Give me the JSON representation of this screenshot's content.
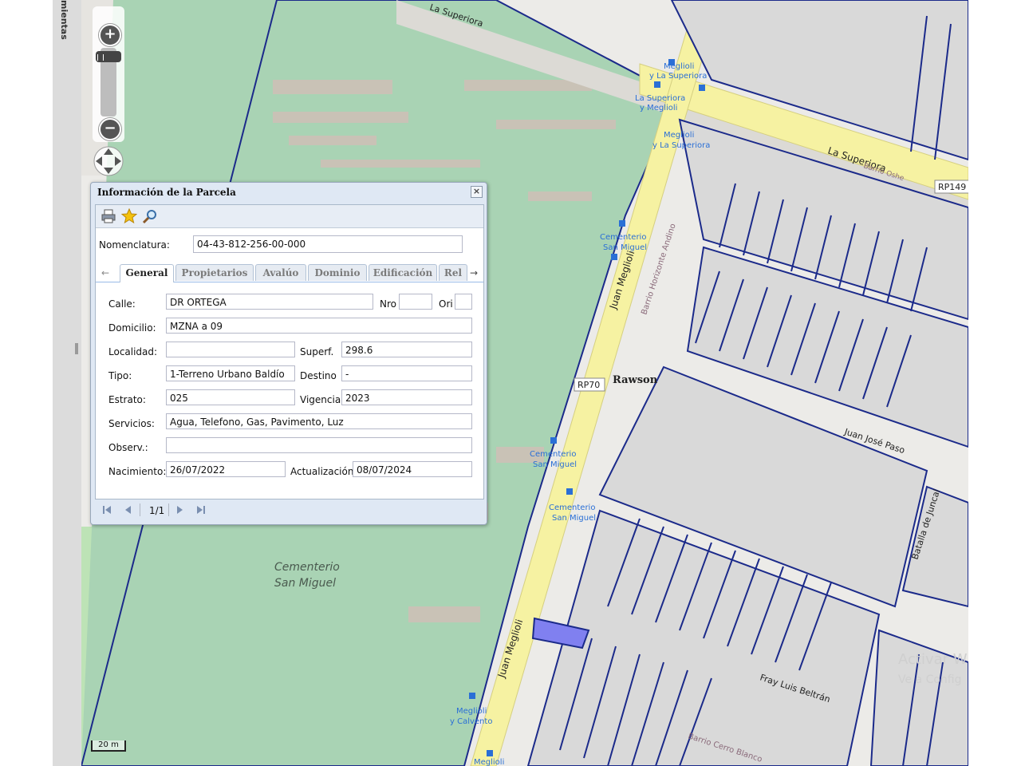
{
  "sidebar": {
    "tab_label": "mientas"
  },
  "map": {
    "scale_label": "20 m",
    "streets": {
      "la_superiora_top": "La Superiora",
      "la_superiora": "La Superiora",
      "rp149": "RP149",
      "rp70": "RP70",
      "juan_meglioli_1": "Juan Meglioli",
      "juan_meglioli_2": "Juan Meglioli",
      "barrio_horizonte": "Barrio Horizonte Andino",
      "rawson": "Rawson",
      "juan_jose_paso": "Juan José Paso",
      "batalla_de_juncal": "Batalla de Juncal",
      "fray_luis_beltran": "Fray Luis Beltrán",
      "barrio_cerro": "Barrio Cerro Blanco",
      "barrio_oshe": "Barrio Oshe"
    },
    "cemetery": {
      "line1": "Cementerio",
      "line2": "San Miguel"
    },
    "stops": {
      "s1a": "Meglioli",
      "s1b": "y La Superiora",
      "s2a": "La Superiora",
      "s2b": "y Meglioli",
      "s3a": "Meglioli",
      "s3b": "y La Superiora",
      "s4a": "Cementerio",
      "s4b": "San Miguel",
      "s5a": "Cementerio",
      "s5b": "San Miguel",
      "s6a": "Cementerio",
      "s6b": "San Miguel",
      "s7a": "Meglioli",
      "s7b": "y Calvento",
      "s8a": "Meglioli"
    },
    "watermark": {
      "line1": "Activar W",
      "line2": "Ve a Config"
    },
    "colors": {
      "parcel_line": "#1b2a8a",
      "road": "#f6f2a2",
      "cemetery": "#a9d3b4",
      "selected": "#8080f0"
    }
  },
  "dialog": {
    "title": "Información de la Parcela",
    "close": "×",
    "toolbar": {
      "print": "print-icon",
      "favorite": "star-icon",
      "search": "magnifier-icon"
    },
    "nomenclatura_label": "Nomenclatura:",
    "nomenclatura_value": "04-43-812-256-00-000",
    "tabs": [
      "General",
      "Propietarios",
      "Avalúo",
      "Dominio",
      "Edificación",
      "Rel"
    ],
    "fields": {
      "calle_label": "Calle:",
      "calle": "DR ORTEGA",
      "nro_label": "Nro",
      "nro": "",
      "ori_label": "Ori",
      "ori": "",
      "domicilio_label": "Domicilio:",
      "domicilio": " MZNA a  09",
      "localidad_label": "Localidad:",
      "localidad": "",
      "superf_label": "Superf.",
      "superf": "298.6",
      "tipo_label": "Tipo:",
      "tipo": "1-Terreno Urbano Baldío",
      "destino_label": "Destino",
      "destino": "-",
      "estrato_label": "Estrato:",
      "estrato": "025",
      "vigencia_label": "Vigencia",
      "vigencia": "2023",
      "servicios_label": "Servicios:",
      "servicios": "Agua, Telefono, Gas, Pavimento, Luz",
      "observ_label": "Observ.:",
      "observ": "",
      "nacimiento_label": "Nacimiento:",
      "nacimiento": "26/07/2022",
      "actualizacion_label": "Actualización",
      "actualizacion": "08/07/2024"
    },
    "pager": {
      "text": "1/1"
    }
  }
}
